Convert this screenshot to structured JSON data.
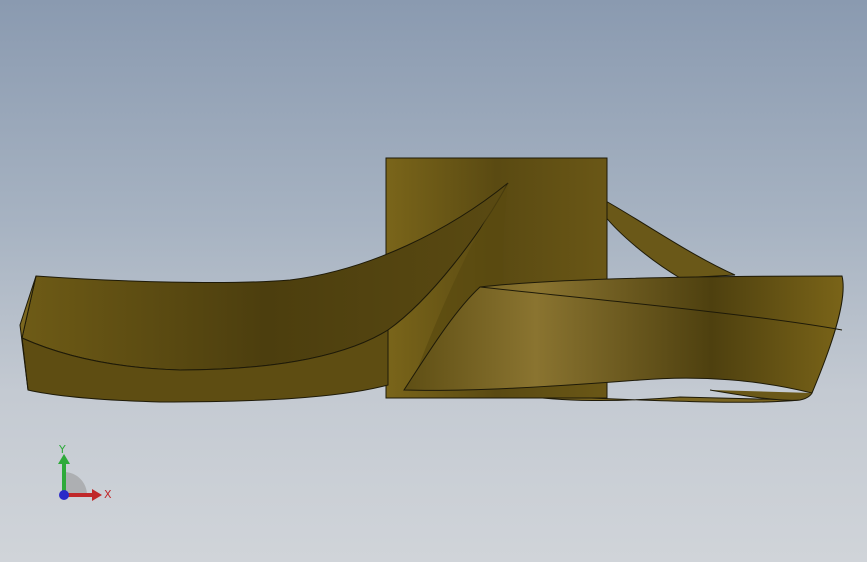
{
  "viewport": {
    "background_top": "#8a9ab0",
    "background_bottom": "#d0d4d9"
  },
  "model": {
    "part": "impeller",
    "material_color": "#6f5c18",
    "edge_color": "#1e1a08"
  },
  "triad": {
    "x_label": "X",
    "y_label": "Y",
    "x_color": "#c0282a",
    "y_color": "#2eaa3a",
    "z_color": "#2a2ac8"
  }
}
